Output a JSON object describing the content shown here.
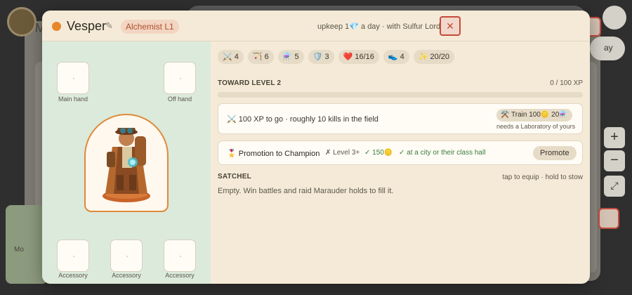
{
  "background": {
    "title_initial": "M",
    "title_initial_2": "Mo",
    "side_button_plus": "+",
    "side_button_minus": "−",
    "side_button_expand": "⤢",
    "side_pill": "ay"
  },
  "unit": {
    "name": "Vesper",
    "status_color": "#e8872a",
    "class_badge": "Alchemist L1",
    "upkeep": "upkeep 1💎 a day · with Sulfur Lord",
    "close_label": "✕"
  },
  "equipment": {
    "main_hand_label": "Main hand",
    "off_hand_label": "Off hand",
    "accessory_labels": [
      "Accessory",
      "Accessory",
      "Accessory"
    ]
  },
  "stats": [
    {
      "icon": "⚔️",
      "value": "4"
    },
    {
      "icon": "🏹",
      "value": "6"
    },
    {
      "icon": "⚗️",
      "value": "5"
    },
    {
      "icon": "🛡️",
      "value": "3"
    },
    {
      "icon": "❤️",
      "value": "16/16"
    },
    {
      "icon": "👟",
      "value": "4"
    },
    {
      "icon": "✨",
      "value": "20/20"
    }
  ],
  "xp": {
    "title": "TOWARD LEVEL 2",
    "count": "0 / 100 XP",
    "progress": 0.0
  },
  "training": {
    "text": "⚔️ 100 XP to go · roughly 10 kills in the field",
    "button": "⚒️ Train 100🪙 20⚗️",
    "note": "needs a Laboratory of yours"
  },
  "promotion": {
    "title": "🎖️ Promotion to Champion",
    "req_level": "✗ Level 3+",
    "req_gold": "✓ 150🪙",
    "req_place": "✓ at a city or their class hall",
    "button": "Promote"
  },
  "satchel": {
    "title": "SATCHEL",
    "hint": "tap to equip · hold to stow",
    "empty": "Empty. Win battles and raid Marauder holds to fill it."
  }
}
